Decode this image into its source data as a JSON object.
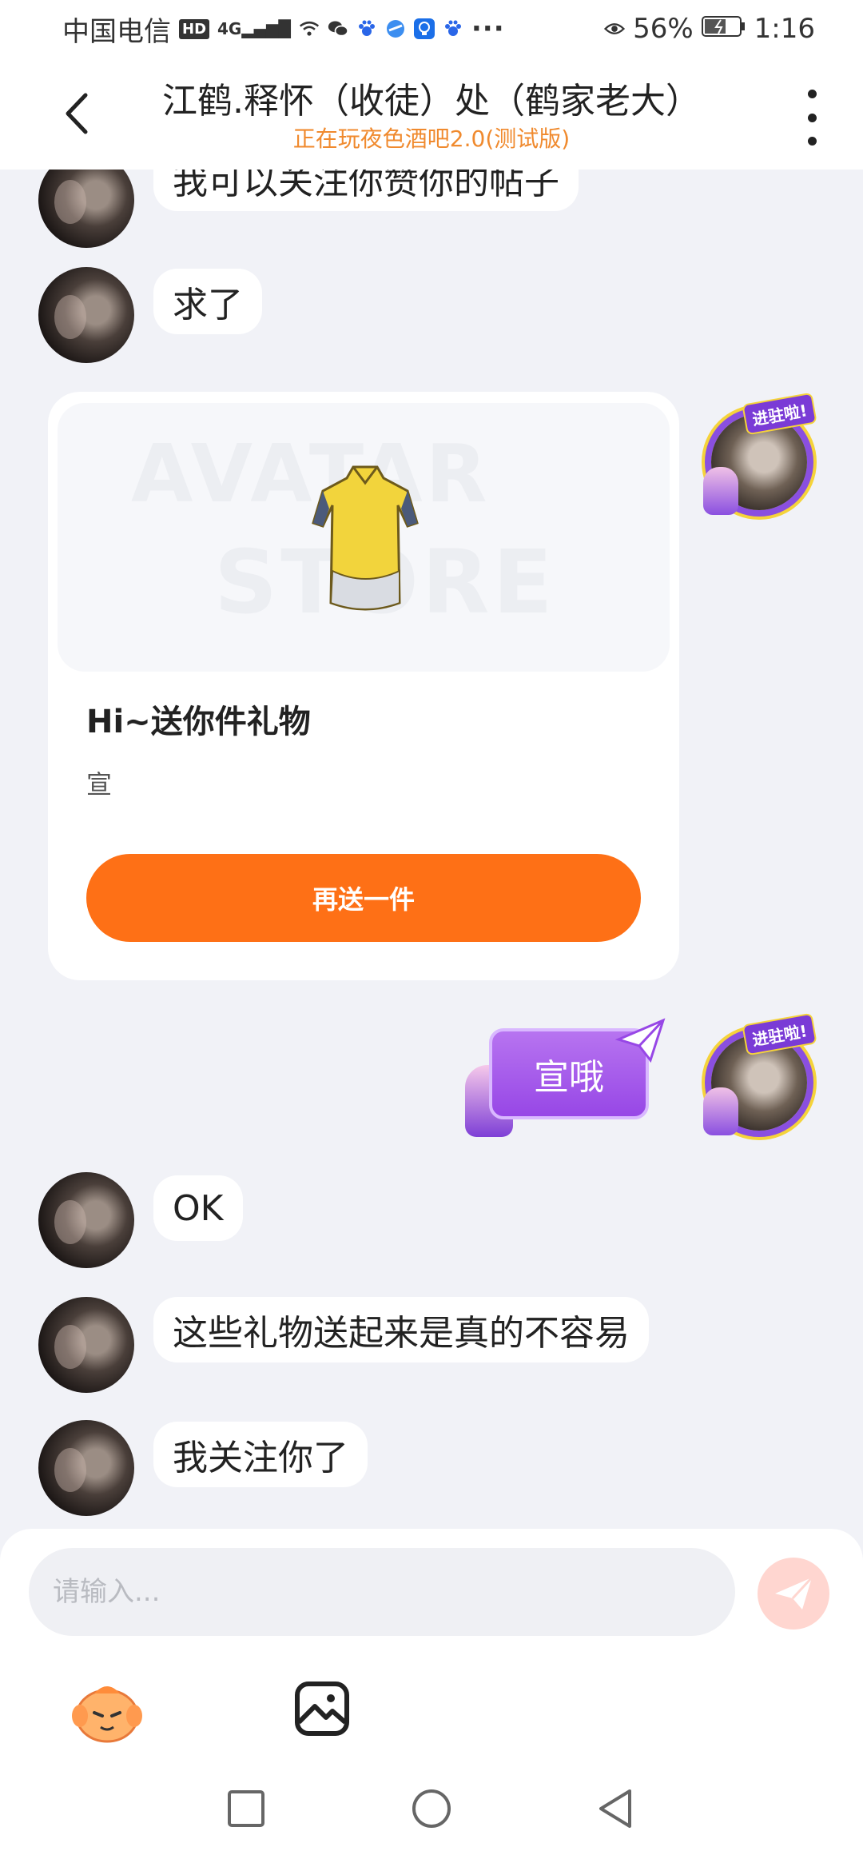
{
  "status_bar": {
    "carrier": "中国电信",
    "hd": "HD",
    "network": "4G",
    "battery": "56%",
    "time": "1:16"
  },
  "header": {
    "title": "江鹤.释怀（收徒）处（鹤家老大）",
    "subtitle": "正在玩夜色酒吧2.0(测试版)"
  },
  "messages": [
    {
      "side": "left",
      "text": "我可以关注你赞你的帖子"
    },
    {
      "side": "left",
      "text": "求了"
    },
    {
      "side": "right",
      "type": "gift"
    },
    {
      "side": "right",
      "type": "sticker",
      "text": "宣哦"
    },
    {
      "side": "left",
      "text": "OK"
    },
    {
      "side": "left",
      "text": "这些礼物送起来是真的不容易"
    },
    {
      "side": "left",
      "text": "我关注你了"
    }
  ],
  "gift_card": {
    "watermark_line1": "AVATAR",
    "watermark_line2": "STORE",
    "title": "Hi~送你件礼物",
    "subtitle": "宣",
    "button_label": "再送一件"
  },
  "avatar_frame_tag": "进驻啦!",
  "input": {
    "placeholder": "请输入..."
  },
  "colors": {
    "accent_orange": "#fe7016",
    "subtitle_orange": "#f08a2e",
    "sticker_purple": "#9747e6",
    "background": "#f1f2f7"
  },
  "icons": [
    "back-icon",
    "more-icon",
    "send-icon",
    "emoji-icon",
    "image-icon",
    "nav-square-icon",
    "nav-circle-icon",
    "nav-back-icon"
  ]
}
